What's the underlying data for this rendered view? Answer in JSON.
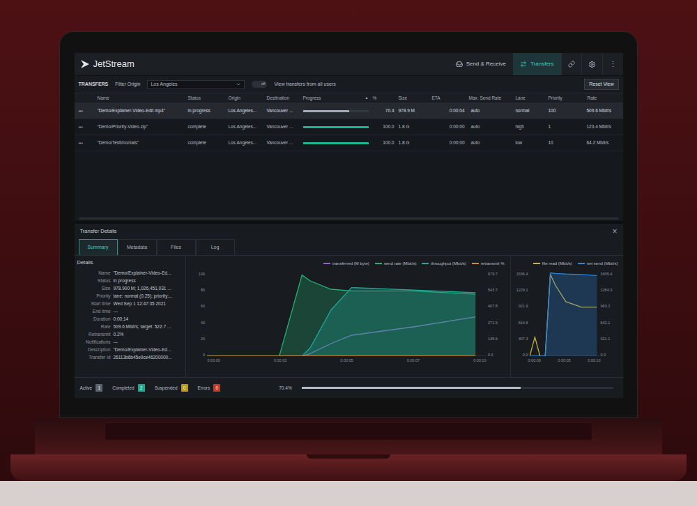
{
  "app": {
    "name": "JetStream"
  },
  "nav": [
    {
      "label": "Send & Receive",
      "selected": false
    },
    {
      "label": "Transfers",
      "selected": true
    }
  ],
  "menu_glyph": "⋮",
  "toolbar": {
    "title": "TRANSFERS",
    "filter_label": "Filter Origin",
    "filter_value": "Los Angeles",
    "toggle": {
      "label": "off",
      "on": false
    },
    "toggle_caption": "View transfers from all users",
    "reset_button": "Reset View"
  },
  "table": {
    "sort_glyph": "▲",
    "columns": [
      {
        "label": "",
        "sorted": false
      },
      {
        "label": "Name",
        "sorted": false
      },
      {
        "label": "Status",
        "sorted": false
      },
      {
        "label": "Origin",
        "sorted": false
      },
      {
        "label": "Destination",
        "sorted": false
      },
      {
        "label": "Progress",
        "sorted": true
      },
      {
        "label": "%",
        "sorted": false
      },
      {
        "label": "Size",
        "sorted": false
      },
      {
        "label": "ETA",
        "sorted": false
      },
      {
        "label": "Max. Send Rate",
        "sorted": false
      },
      {
        "label": "Lane",
        "sorted": false
      },
      {
        "label": "Priority",
        "sorted": false
      },
      {
        "label": "Rate",
        "sorted": false
      }
    ],
    "rows": [
      {
        "menu": "•••",
        "name": "\"Demo/Explainer-Video-Edit.mp4\"",
        "status": "in progress",
        "origin": "Los Angeles...",
        "destination": "Vancouver ...",
        "level": 0.704,
        "color": "#a3abb5",
        "percent": "70.4",
        "size": "978.9 M",
        "eta": "0:00:04",
        "max_send_rate": "auto",
        "lane": "normal",
        "priority": "100",
        "rate": "509.6 Mbit/s",
        "selected": true
      },
      {
        "menu": "•••",
        "name": "\"Demo/Priority-Video.zip\"",
        "status": "complete",
        "origin": "Los Angeles...",
        "destination": "Vancouver ...",
        "level": 1.0,
        "color": "#1fb58f",
        "percent": "100.0",
        "size": "1.8 G",
        "eta": "0:00:00",
        "max_send_rate": "auto",
        "lane": "high",
        "priority": "1",
        "rate": "123.4 Mbit/s",
        "selected": false
      },
      {
        "menu": "•••",
        "name": "\"Demo/Testimonials\"",
        "status": "complete",
        "origin": "Los Angeles...",
        "destination": "Vancouver ...",
        "level": 1.0,
        "color": "#1fb58f",
        "percent": "100.0",
        "size": "1.8 G",
        "eta": "0:00:00",
        "max_send_rate": "auto",
        "lane": "low",
        "priority": "10",
        "rate": "64.2 Mbit/s",
        "selected": false
      }
    ]
  },
  "details_panel": {
    "title": "Transfer Details",
    "close_glyph": "×",
    "tabs": [
      {
        "label": "Summary",
        "selected": true
      },
      {
        "label": "Metadata",
        "selected": false
      },
      {
        "label": "Files",
        "selected": false
      },
      {
        "label": "Log",
        "selected": false
      }
    ],
    "heading": "Details",
    "fields": [
      {
        "label": "Name",
        "value": "\"Demo/Explainer-Video-Ed..."
      },
      {
        "label": "Status",
        "value": "in progress"
      },
      {
        "label": "Size",
        "value": "978.900 M; 1,026,451,031 ..."
      },
      {
        "label": "Priority",
        "value": "lane: normal (0.25); priority:..."
      },
      {
        "label": "Start time",
        "value": "Wed Sep 1 12:47:35 2021"
      },
      {
        "label": "End time",
        "value": "---"
      },
      {
        "label": "Duration",
        "value": "0:00:14"
      },
      {
        "label": "Rate",
        "value": "509.6 Mbit/s; target: 522.7 ..."
      },
      {
        "label": "Retransmit",
        "value": "0.2%"
      },
      {
        "label": "Notifications",
        "value": "---"
      },
      {
        "label": "Description",
        "value": "\"Demo/Explainer-Video-Ed..."
      },
      {
        "label": "Transfer Id",
        "value": "26113b6b45e9ce46200000..."
      }
    ]
  },
  "chart_main": {
    "x": [
      0,
      2,
      3.5,
      4.6,
      5,
      6,
      7,
      10,
      13
    ],
    "x_max": 13.5,
    "y_max": 100,
    "series": [
      {
        "name": "transferred (M byte)",
        "color": "#9a5fd0",
        "area": false,
        "values": [
          0,
          0,
          0,
          0,
          3,
          15,
          25,
          35,
          47
        ]
      },
      {
        "name": "send rate (Mbit/s)",
        "color": "#21b573",
        "area": true,
        "values": [
          0,
          0,
          0,
          97,
          90,
          80,
          78,
          78,
          74
        ]
      },
      {
        "name": "throughput (Mbit/s)",
        "color": "#1fa89a",
        "area": true,
        "values": [
          0,
          0,
          0,
          0,
          10,
          55,
          82,
          79,
          76
        ]
      },
      {
        "name": "retransmit %",
        "color": "#e0862a",
        "area": false,
        "values": [
          0,
          0,
          0,
          0,
          0,
          0,
          0,
          0,
          0
        ]
      }
    ],
    "y_left_ticks": [
      "100",
      "80",
      "60",
      "40",
      "20",
      "0"
    ],
    "y_right_ticks": [
      "679.7",
      "543.7",
      "407.8",
      "271.9",
      "135.9",
      "0.0"
    ],
    "x_ticks": [
      "0:00:00",
      "0:00:02",
      "0:00:05",
      "0:00:07",
      "0:00:10"
    ]
  },
  "chart_io": {
    "x": [
      0,
      1,
      2,
      3,
      4,
      5,
      7,
      10,
      13
    ],
    "x_max": 13.5,
    "y_max": 1536.4,
    "series": [
      {
        "name": "file read (Mbit/s)",
        "color": "#c9b43a",
        "area": false,
        "values": [
          0,
          350,
          0,
          0,
          1500,
          1300,
          1000,
          900,
          900
        ]
      },
      {
        "name": "net send (Mbit/s)",
        "color": "#2f86d6",
        "area": true,
        "values": [
          0,
          0,
          0,
          0,
          1530,
          1520,
          1510,
          1500,
          1480
        ]
      }
    ],
    "y_left_ticks": [
      "1536.4",
      "1229.1",
      "921.9",
      "614.6",
      "307.3",
      "0.0"
    ],
    "y_right_ticks": [
      "1605.4",
      "1284.3",
      "963.2",
      "642.1",
      "321.1",
      "0.0"
    ],
    "x_ticks": [
      "0:00:00",
      "0:00:05",
      "0:00:10"
    ]
  },
  "status_bar": {
    "counts": [
      {
        "label": "Active",
        "count": "1",
        "color": "#5b636d"
      },
      {
        "label": "Completed",
        "count": "2",
        "color": "#1fa88a"
      },
      {
        "label": "Suspended",
        "count": "0",
        "color": "#b89a1c"
      },
      {
        "label": "Errors",
        "count": "0",
        "color": "#c0392b"
      }
    ],
    "overall": {
      "reading": "70.4%",
      "level": 0.704
    }
  }
}
